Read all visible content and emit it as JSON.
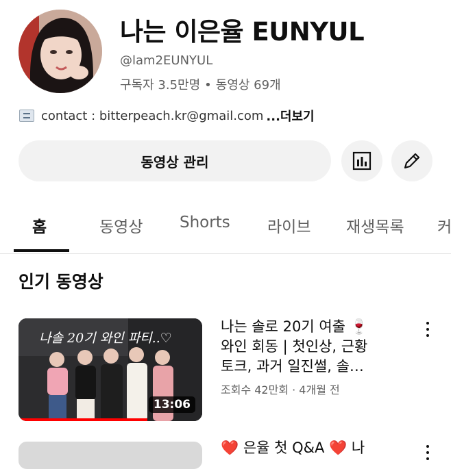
{
  "channel": {
    "name": "나는 이은율 EUNYUL",
    "handle": "@lam2EUNYUL",
    "subscribers": "구독자 3.5만명",
    "separator": "•",
    "videos": "동영상 69개",
    "description": "contact : bitterpeach.kr@gmail.com",
    "more_label": "...더보기"
  },
  "actions": {
    "manage_label": "동영상 관리",
    "analytics_icon": "analytics-icon",
    "edit_icon": "pencil-icon"
  },
  "tabs": [
    {
      "label": "홈",
      "active": true
    },
    {
      "label": "동영상",
      "active": false
    },
    {
      "label": "Shorts",
      "active": false
    },
    {
      "label": "라이브",
      "active": false
    },
    {
      "label": "재생목록",
      "active": false
    },
    {
      "label": "커",
      "active": false
    }
  ],
  "section": {
    "title": "인기 동영상"
  },
  "videos": [
    {
      "thumbnail_text": "나솔 20기 와인 파티..♡",
      "duration": "13:06",
      "title_lines": [
        "나는 솔로 20기 여출 🍷",
        "와인 회동 | 첫인상, 근황",
        "토크, 과거 일진썰, 솔…"
      ],
      "meta": "조회수 42만회 · 4개월 전",
      "watch_progress": 0.7
    },
    {
      "title_partial": "❤️ 은율 첫 Q&A ❤️ 나"
    }
  ],
  "colors": {
    "accent": "#ff0000",
    "text_primary": "#0f0f0f",
    "text_secondary": "#606060",
    "button_bg": "#f2f2f2"
  }
}
